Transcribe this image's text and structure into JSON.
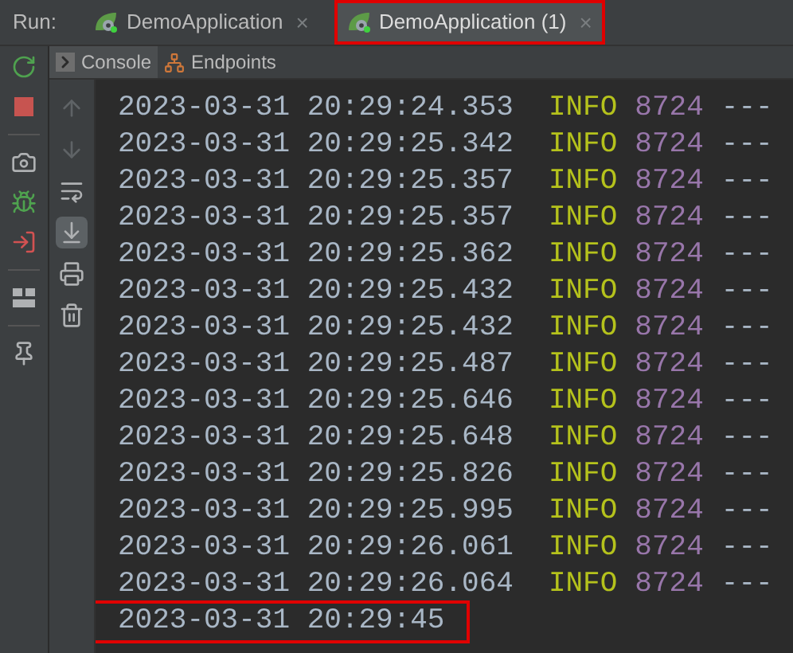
{
  "run_bar": {
    "label": "Run:",
    "tabs": [
      {
        "label": "DemoApplication",
        "selected": false,
        "highlighted": false,
        "close": "×"
      },
      {
        "label": "DemoApplication (1)",
        "selected": true,
        "highlighted": true,
        "close": "×"
      }
    ]
  },
  "main_toolbar": [
    {
      "kind": "rerun"
    },
    {
      "kind": "stop"
    },
    {
      "kind": "separator"
    },
    {
      "kind": "camera"
    },
    {
      "kind": "debug"
    },
    {
      "kind": "login"
    },
    {
      "kind": "separator"
    },
    {
      "kind": "layout"
    },
    {
      "kind": "separator"
    },
    {
      "kind": "pin"
    }
  ],
  "view_tabs": [
    {
      "label": "Console",
      "kind": "console",
      "selected": true
    },
    {
      "label": "Endpoints",
      "kind": "endpoints",
      "selected": false
    }
  ],
  "console_toolbar": [
    {
      "kind": "up",
      "disabled": true,
      "selected": false
    },
    {
      "kind": "down",
      "disabled": true,
      "selected": false
    },
    {
      "kind": "wrap",
      "disabled": false,
      "selected": false
    },
    {
      "kind": "scroll",
      "disabled": false,
      "selected": true
    },
    {
      "kind": "print",
      "disabled": false,
      "selected": false
    },
    {
      "kind": "trash",
      "disabled": false,
      "selected": false
    }
  ],
  "log_lines": [
    {
      "timestamp": "2023-03-31 20:29:24.353",
      "level": "INFO",
      "pid": "8724",
      "rest": "---",
      "highlighted": false
    },
    {
      "timestamp": "2023-03-31 20:29:25.342",
      "level": "INFO",
      "pid": "8724",
      "rest": "---",
      "highlighted": false
    },
    {
      "timestamp": "2023-03-31 20:29:25.357",
      "level": "INFO",
      "pid": "8724",
      "rest": "---",
      "highlighted": false
    },
    {
      "timestamp": "2023-03-31 20:29:25.357",
      "level": "INFO",
      "pid": "8724",
      "rest": "---",
      "highlighted": false
    },
    {
      "timestamp": "2023-03-31 20:29:25.362",
      "level": "INFO",
      "pid": "8724",
      "rest": "---",
      "highlighted": false
    },
    {
      "timestamp": "2023-03-31 20:29:25.432",
      "level": "INFO",
      "pid": "8724",
      "rest": "---",
      "highlighted": false
    },
    {
      "timestamp": "2023-03-31 20:29:25.432",
      "level": "INFO",
      "pid": "8724",
      "rest": "---",
      "highlighted": false
    },
    {
      "timestamp": "2023-03-31 20:29:25.487",
      "level": "INFO",
      "pid": "8724",
      "rest": "---",
      "highlighted": false
    },
    {
      "timestamp": "2023-03-31 20:29:25.646",
      "level": "INFO",
      "pid": "8724",
      "rest": "---",
      "highlighted": false
    },
    {
      "timestamp": "2023-03-31 20:29:25.648",
      "level": "INFO",
      "pid": "8724",
      "rest": "---",
      "highlighted": false
    },
    {
      "timestamp": "2023-03-31 20:29:25.826",
      "level": "INFO",
      "pid": "8724",
      "rest": "---",
      "highlighted": false
    },
    {
      "timestamp": "2023-03-31 20:29:25.995",
      "level": "INFO",
      "pid": "8724",
      "rest": "---",
      "highlighted": false
    },
    {
      "timestamp": "2023-03-31 20:29:26.061",
      "level": "INFO",
      "pid": "8724",
      "rest": "---",
      "highlighted": false
    },
    {
      "timestamp": "2023-03-31 20:29:26.064",
      "level": "INFO",
      "pid": "8724",
      "rest": "---",
      "highlighted": false
    },
    {
      "timestamp": "2023-03-31 20:29:45",
      "highlighted": true
    }
  ]
}
